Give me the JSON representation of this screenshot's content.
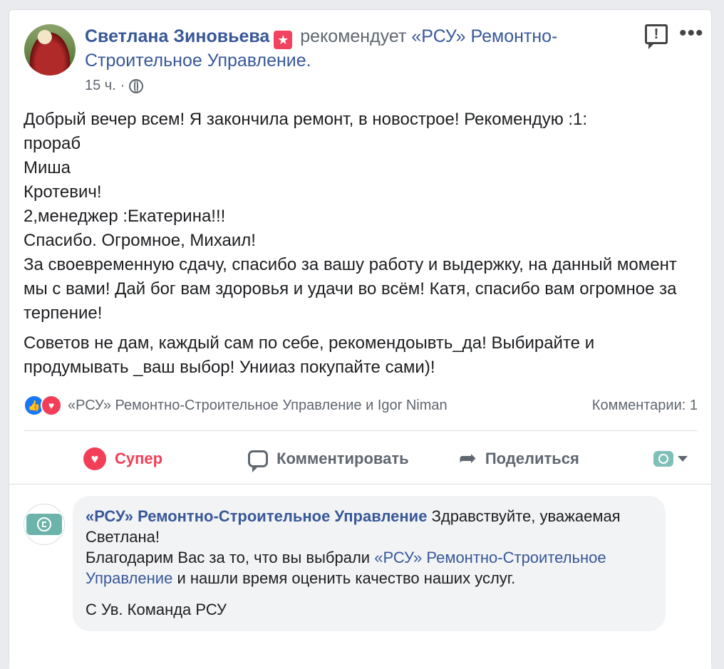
{
  "post": {
    "author": "Светлана Зиновьева",
    "recommend_badge_icon": "recommend-star-icon",
    "recommends_text": "рекомендует",
    "page_name": "«РСУ» Ремонтно-Строительное Управление",
    "page_suffix": ".",
    "time": "15 ч.",
    "separator": "·",
    "paragraph1": "Добрый вечер всем! Я закончила ремонт, в новострое! Рекомендую :1:\nпрораб\nМиша\nКротевич!\n2,менеджер :Екатерина!!!\nСпасибо. Огромное, Михаил!\nЗа своевременную сдачу, спасибо за вашу работу и выдержку, на данный момент мы с вами! Дай бог вам здоровья и удачи во всём! Катя, спасибо вам огромное за терпение!",
    "paragraph2": "Советов не дам, каждый сам по себе, рекомендоывть_да! Выбирайте и продумывать _ваш выбор! Унииаз покупайте сами)!"
  },
  "reactions": {
    "reactors": "«РСУ» Ремонтно-Строительное Управление и Igor Niman",
    "comments_count": "Комментарии: 1"
  },
  "actions": {
    "super_label": "Супер",
    "comment_label": "Комментировать",
    "share_label": "Поделиться"
  },
  "comment": {
    "author": "«РСУ» Ремонтно-Строительное Управление",
    "line1": "Здравствуйте, уважаемая Светлана!",
    "line2_prefix": "Благодарим Вас за то, что вы выбрали",
    "line2_link": "«РСУ» Ремонтно-Строительное Управление",
    "line2_suffix": "и нашли время оценить качество наших услуг.",
    "signature": "С Ув. Команда РСУ"
  },
  "colors": {
    "link": "#385898",
    "love": "#f33e58",
    "like": "#1877f2",
    "muted": "#606770",
    "bubble": "#f2f3f5"
  }
}
